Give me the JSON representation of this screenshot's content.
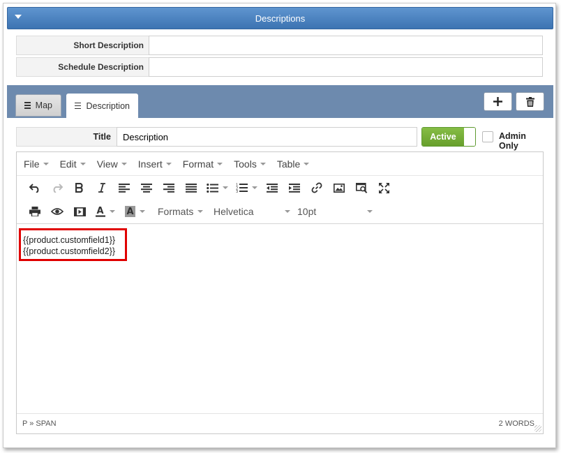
{
  "panel": {
    "title": "Descriptions"
  },
  "fields": {
    "short_description": {
      "label": "Short Description",
      "value": ""
    },
    "schedule_description": {
      "label": "Schedule Description",
      "value": ""
    }
  },
  "tabs": [
    {
      "label": "Map",
      "active": false
    },
    {
      "label": "Description",
      "active": true
    }
  ],
  "actions": {
    "add_icon": "plus-icon",
    "delete_icon": "trash-icon"
  },
  "title_field": {
    "label": "Title",
    "value": "Description"
  },
  "active_toggle": {
    "label": "Active",
    "state": true
  },
  "admin_only": {
    "label": "Admin Only",
    "checked": false
  },
  "editor": {
    "menus": [
      "File",
      "Edit",
      "View",
      "Insert",
      "Format",
      "Tools",
      "Table"
    ],
    "formats_label": "Formats",
    "font_family": "Helvetica",
    "font_size": "10pt",
    "content_lines": [
      "{{product.customfield1}}",
      "{{product.customfield2}}"
    ],
    "path": "P » SPAN",
    "word_count": "2 WORDS"
  },
  "colors": {
    "header_blue": "#4a82c0",
    "tabbar": "#6d8aae",
    "active_green": "#75ab37",
    "highlight_red": "#e00000"
  }
}
